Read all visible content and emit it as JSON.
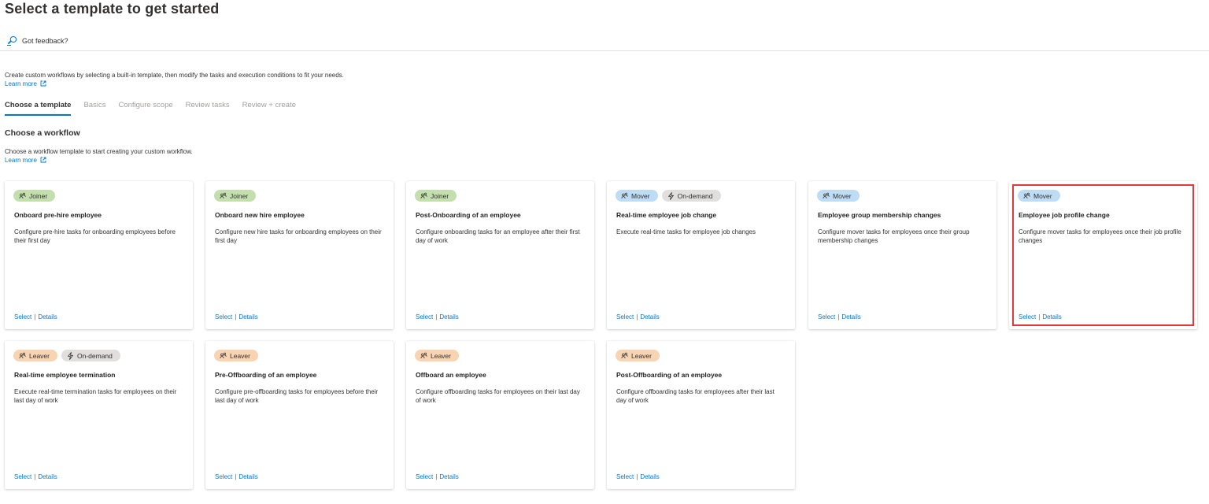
{
  "header": {
    "title": "Select a template to get started",
    "more": "···"
  },
  "commandbar": {
    "feedback_label": "Got feedback?"
  },
  "intro": {
    "text": "Create custom workflows by selecting a built-in template, then modify the tasks and execution conditions to fit your needs.",
    "learn_more": "Learn more"
  },
  "tabs": [
    {
      "label": "Choose a template",
      "active": true
    },
    {
      "label": "Basics",
      "active": false
    },
    {
      "label": "Configure scope",
      "active": false
    },
    {
      "label": "Review tasks",
      "active": false
    },
    {
      "label": "Review + create",
      "active": false
    }
  ],
  "section": {
    "title": "Choose a workflow",
    "description": "Choose a workflow template to start creating your custom workflow.",
    "learn_more": "Learn more"
  },
  "cards": [
    {
      "tags": [
        "Joiner"
      ],
      "title": "Onboard pre-hire employee",
      "description": "Configure pre-hire tasks for onboarding employees before their first day",
      "select": "Select",
      "details": "Details",
      "highlighted": false
    },
    {
      "tags": [
        "Joiner"
      ],
      "title": "Onboard new hire employee",
      "description": "Configure new hire tasks for onboarding employees on their first day",
      "select": "Select",
      "details": "Details",
      "highlighted": false
    },
    {
      "tags": [
        "Joiner"
      ],
      "title": "Post-Onboarding of an employee",
      "description": "Configure onboarding tasks for an employee after their first day of work",
      "select": "Select",
      "details": "Details",
      "highlighted": false
    },
    {
      "tags": [
        "Mover",
        "On-demand"
      ],
      "title": "Real-time employee job change",
      "description": "Execute real-time tasks for employee job changes",
      "select": "Select",
      "details": "Details",
      "highlighted": false
    },
    {
      "tags": [
        "Mover"
      ],
      "title": "Employee group membership changes",
      "description": "Configure mover tasks for employees once their group membership changes",
      "select": "Select",
      "details": "Details",
      "highlighted": false
    },
    {
      "tags": [
        "Mover"
      ],
      "title": "Employee job profile change",
      "description": "Configure mover tasks for employees once their job profile changes",
      "select": "Select",
      "details": "Details",
      "highlighted": true
    },
    {
      "tags": [
        "Leaver",
        "On-demand"
      ],
      "title": "Real-time employee termination",
      "description": "Execute real-time termination tasks for employees on their last day of work",
      "select": "Select",
      "details": "Details",
      "highlighted": false
    },
    {
      "tags": [
        "Leaver"
      ],
      "title": "Pre-Offboarding of an employee",
      "description": "Configure pre-offboarding tasks for employees before their last day of work",
      "select": "Select",
      "details": "Details",
      "highlighted": false
    },
    {
      "tags": [
        "Leaver"
      ],
      "title": "Offboard an employee",
      "description": "Configure offboarding tasks for employees on their last day of work",
      "select": "Select",
      "details": "Details",
      "highlighted": false
    },
    {
      "tags": [
        "Leaver"
      ],
      "title": "Post-Offboarding of an employee",
      "description": "Configure offboarding tasks for employees after their last day of work",
      "select": "Select",
      "details": "Details",
      "highlighted": false
    }
  ],
  "colors": {
    "accent": "#0078d4",
    "joiner": "#c4dfae",
    "mover": "#bfdcf5",
    "leaver": "#f8d4b3",
    "ondemand": "#e1dfdd",
    "highlight": "#e0393e"
  },
  "icons": {
    "feedback": "feedback-icon",
    "external": "open-external-icon",
    "people": "people-icon",
    "lightning": "lightning-icon"
  }
}
